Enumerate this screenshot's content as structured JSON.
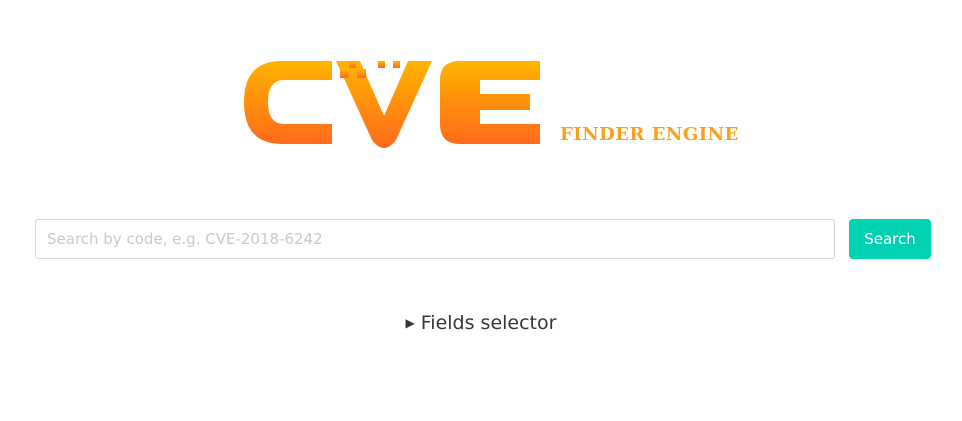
{
  "logo": {
    "text": "CVE",
    "tagline": "FINDER ENGINE",
    "gradient_top": "#ffb400",
    "gradient_bottom": "#ff6a1a",
    "tagline_color": "#f7a21a"
  },
  "search": {
    "placeholder": "Search by code, e.g. CVE-2018-6242",
    "value": "",
    "button_label": "Search",
    "button_color": "#00d1b2"
  },
  "fields_selector": {
    "marker_icon": "triangle-right-icon",
    "label": "Fields selector"
  }
}
